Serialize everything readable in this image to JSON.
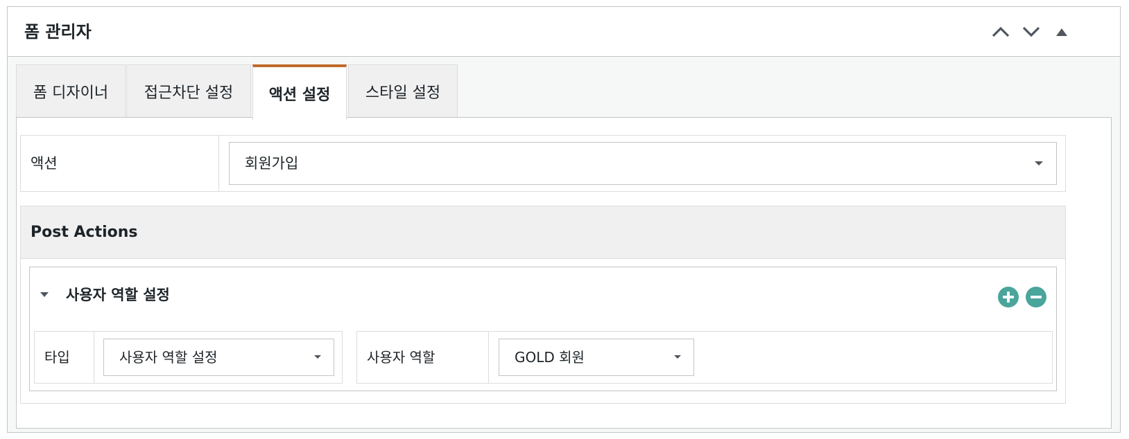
{
  "panel": {
    "title": "폼 관리자",
    "controls": [
      "chevron-up-icon",
      "chevron-down-icon",
      "triangle-up-icon"
    ]
  },
  "tabs": [
    {
      "label": "폼 디자이너",
      "active": false
    },
    {
      "label": "접근차단 설정",
      "active": false
    },
    {
      "label": "액션 설정",
      "active": true
    },
    {
      "label": "스타일 설정",
      "active": false
    }
  ],
  "action_row": {
    "label": "액션",
    "selected": "회원가입"
  },
  "post_actions": {
    "title": "Post Actions",
    "item": {
      "title": "사용자 역할 설정",
      "type_label": "타입",
      "type_value": "사용자 역할 설정",
      "role_label": "사용자 역할",
      "role_value": "GOLD 회원"
    }
  },
  "colors": {
    "active_tab_accent": "#c06a2b",
    "circle_button": "#4aa59b"
  }
}
